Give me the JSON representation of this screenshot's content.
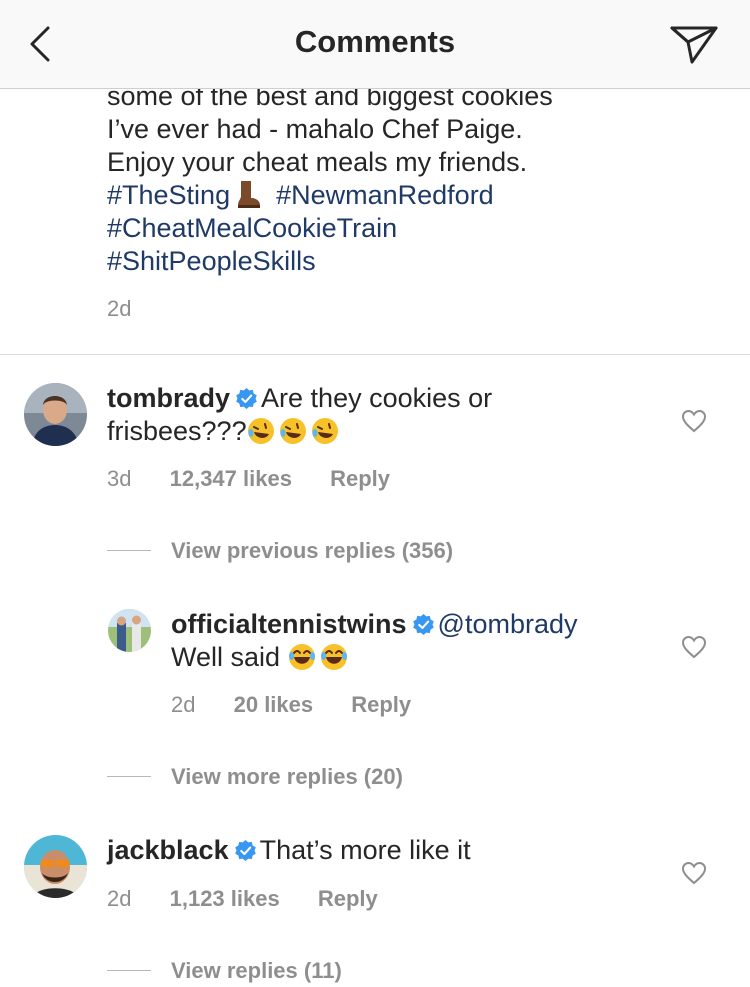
{
  "header": {
    "title": "Comments",
    "back_icon": "chevron-left-icon",
    "share_icon": "paper-plane-icon"
  },
  "caption": {
    "lines": [
      "some of the best and biggest cookies",
      "I’ve ever had - mahalo Chef Paige.",
      "Enjoy your cheat meals my friends."
    ],
    "hashtag_1": "#TheSting",
    "hashtag_1_emoji": "boot-emoji",
    "hashtag_2": "#NewmanRedford",
    "hashtag_3": "#CheatMealCookieTrain",
    "hashtag_4": "#ShitPeopleSkills",
    "time": "2d"
  },
  "comments": [
    {
      "username": "tombrady",
      "text_line_1": "Are they cookies or",
      "text_line_2": "frisbees???",
      "emojis": [
        "rofl-emoji",
        "rofl-emoji",
        "rofl-emoji"
      ],
      "time": "3d",
      "likes": "12,347 likes",
      "reply": "Reply",
      "view_replies": "View previous replies (356)"
    },
    {
      "username": "officialtennistwins",
      "mention": "@tombrady",
      "text_line_2": "Well said",
      "emojis": [
        "joy-emoji",
        "joy-emoji"
      ],
      "time": "2d",
      "likes": "20 likes",
      "reply": "Reply",
      "view_replies": "View more replies (20)"
    },
    {
      "username": "jackblack",
      "text_line_1": "That’s more like it",
      "time": "2d",
      "likes": "1,123 likes",
      "reply": "Reply",
      "view_replies": "View replies (11)"
    }
  ],
  "colors": {
    "hashtag": "#1f3a66",
    "verified": "#3897f0",
    "secondary_text": "#8e8e8e",
    "primary_text": "#262626"
  }
}
